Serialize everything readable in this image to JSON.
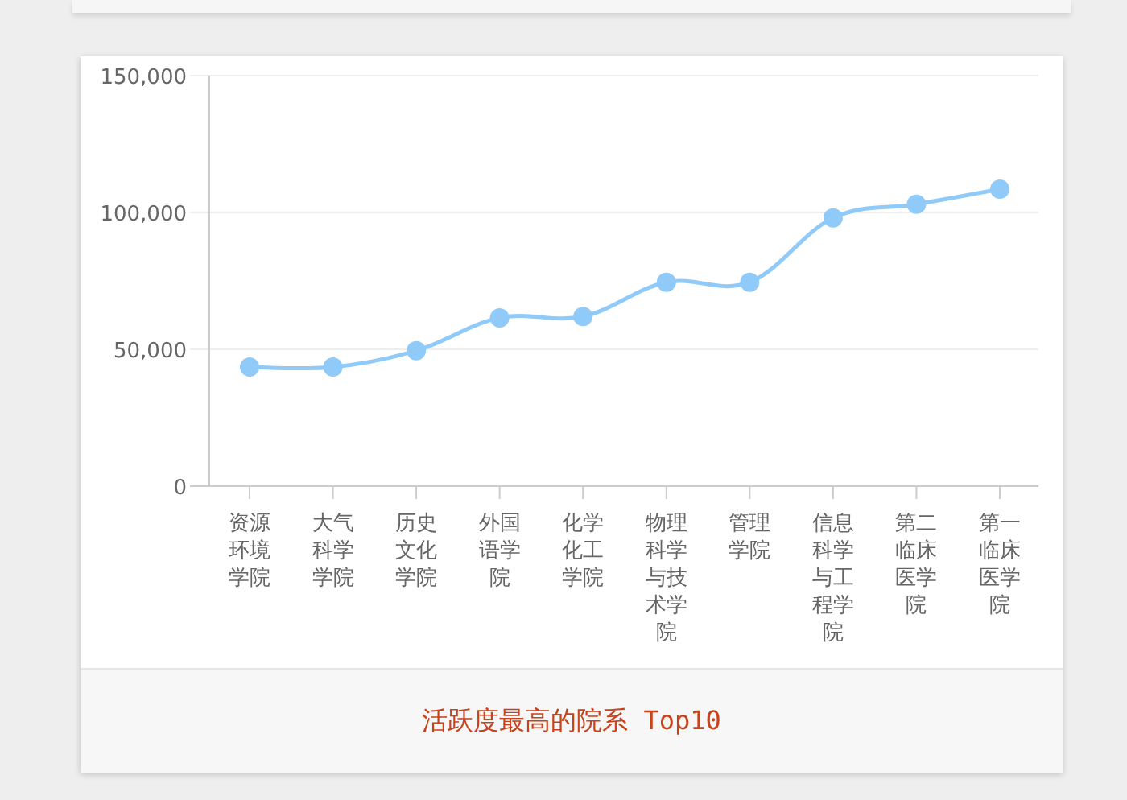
{
  "chart": {
    "chart_data": {
      "type": "line",
      "categories": [
        "资源环境学院",
        "大气科学学院",
        "历史文化学院",
        "外国语学院",
        "化学化工学院",
        "物理科学与技术学院",
        "管理学院",
        "信息科学与工程学院",
        "第二临床医学院",
        "第一临床医学院"
      ],
      "series": [
        {
          "color": "#90caf9",
          "marker": "circle",
          "values": [
            43500,
            43500,
            49500,
            61500,
            62000,
            74500,
            74500,
            98000,
            103000,
            108500
          ]
        }
      ],
      "ylim": [
        0,
        150000
      ],
      "yticks": [
        {
          "value": 0,
          "label": "0"
        },
        {
          "value": 50000,
          "label": "50,000"
        },
        {
          "value": 100000,
          "label": "100,000"
        },
        {
          "value": 150000,
          "label": "150,000"
        }
      ]
    }
  },
  "caption": "活跃度最高的院系 Top10"
}
